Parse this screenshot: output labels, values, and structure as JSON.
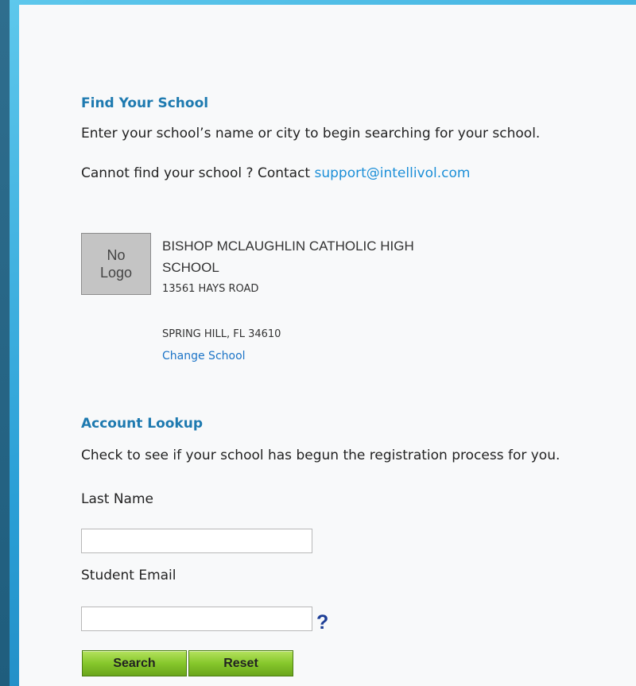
{
  "find_school": {
    "heading": "Find Your School",
    "instructions": "Enter your school’s name or city to begin searching for your school.",
    "cannot_find_text": "Cannot find your school ? Contact ",
    "support_email": "support@intellivol.com"
  },
  "school": {
    "logo_line1": "No",
    "logo_line2": "Logo",
    "name": "BISHOP MCLAUGHLIN CATHOLIC HIGH SCHOOL",
    "address": "13561 HAYS ROAD",
    "city_state_zip": "SPRING HILL, FL 34610",
    "change_label": "Change School"
  },
  "account_lookup": {
    "heading": "Account Lookup",
    "instructions": "Check to see if your school has begun the registration process for you.",
    "last_name_label": "Last Name",
    "last_name_value": "",
    "student_email_label": "Student Email",
    "student_email_value": "",
    "help_symbol": "?",
    "search_label": "Search",
    "reset_label": "Reset"
  },
  "icons": {
    "help": "question-mark-icon"
  },
  "colors": {
    "heading": "#1e7ab0",
    "link": "#1c8fd8",
    "button": "#86c72b",
    "help_icon": "#1d3e96"
  }
}
